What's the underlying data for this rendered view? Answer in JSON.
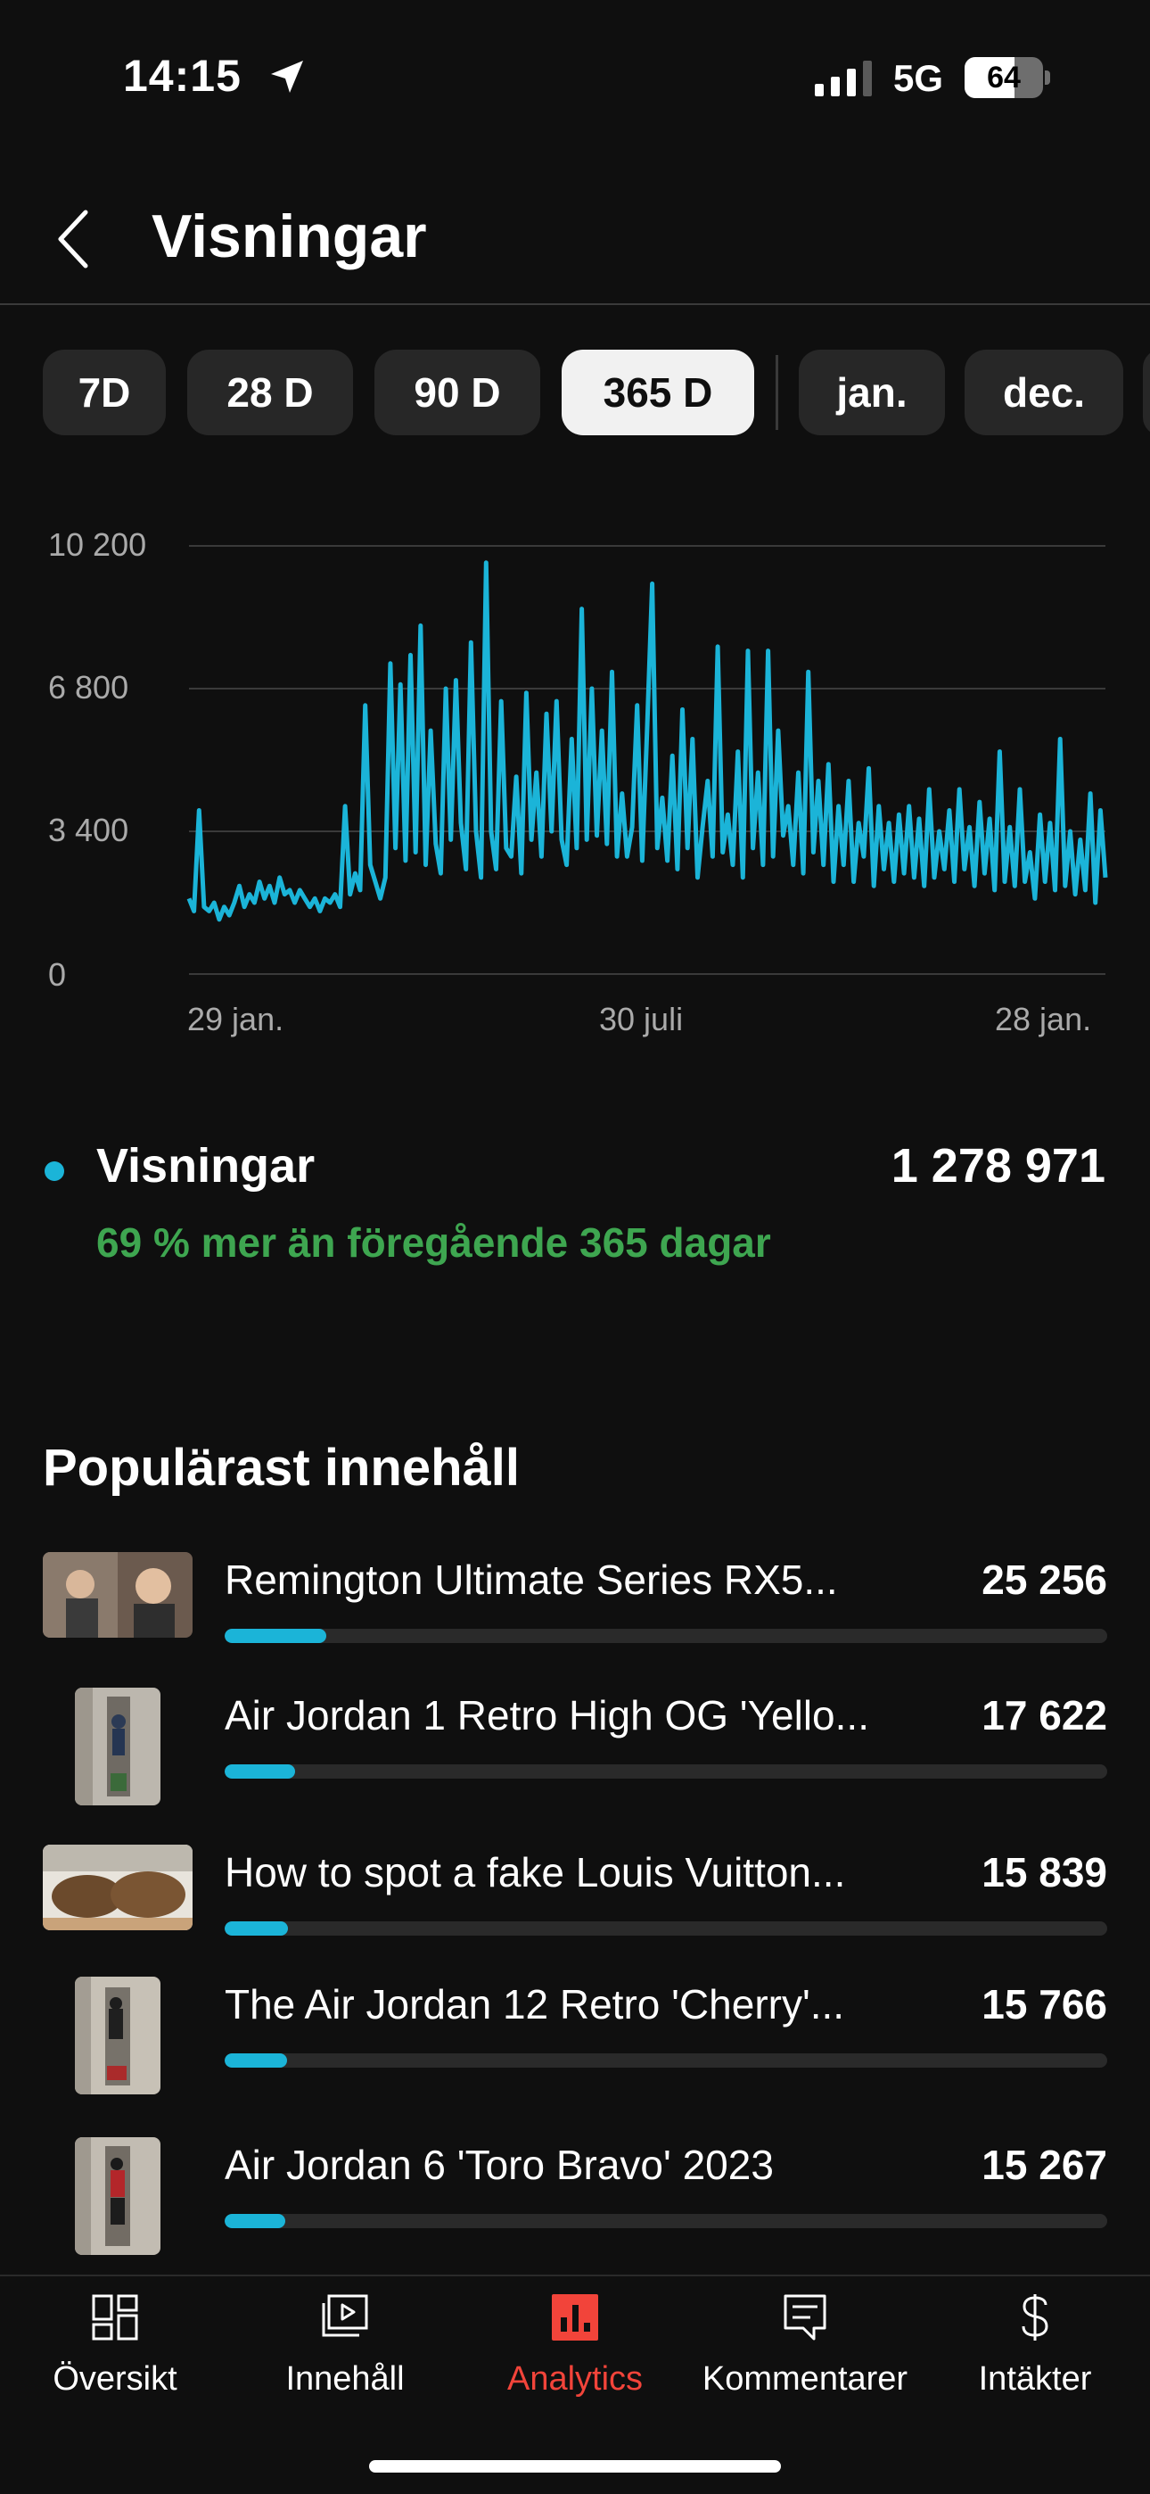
{
  "status": {
    "time": "14:15",
    "network": "5G",
    "battery": "64",
    "battery_level": 0.64
  },
  "header": {
    "title": "Visningar"
  },
  "periods": [
    {
      "label": "7D",
      "active": false
    },
    {
      "label": "28 D",
      "active": false
    },
    {
      "label": "90 D",
      "active": false
    },
    {
      "label": "365 D",
      "active": true
    },
    {
      "label": "jan.",
      "active": false
    },
    {
      "label": "dec.",
      "active": false
    }
  ],
  "chart_data": {
    "type": "line",
    "series_color": "#1bb4d8",
    "yticks": [
      "10 200",
      "6 800",
      "3 400",
      "0"
    ],
    "ytick_values": [
      10200,
      6800,
      3400,
      0
    ],
    "ylim": [
      0,
      10200
    ],
    "xticks": [
      "29 jan.",
      "30 juli",
      "28 jan."
    ],
    "x_range_days": [
      0,
      364
    ],
    "xtick_days": [
      0,
      182,
      364
    ],
    "grid": true,
    "series": [
      {
        "points": [
          [
            0,
            1800
          ],
          [
            2,
            1500
          ],
          [
            4,
            3900
          ],
          [
            6,
            1600
          ],
          [
            8,
            1500
          ],
          [
            10,
            1700
          ],
          [
            12,
            1300
          ],
          [
            14,
            1600
          ],
          [
            16,
            1400
          ],
          [
            18,
            1700
          ],
          [
            20,
            2100
          ],
          [
            22,
            1600
          ],
          [
            24,
            1900
          ],
          [
            26,
            1700
          ],
          [
            28,
            2200
          ],
          [
            30,
            1800
          ],
          [
            32,
            2100
          ],
          [
            34,
            1700
          ],
          [
            36,
            2300
          ],
          [
            38,
            1900
          ],
          [
            40,
            2000
          ],
          [
            42,
            1700
          ],
          [
            44,
            2000
          ],
          [
            46,
            1800
          ],
          [
            48,
            1600
          ],
          [
            50,
            1800
          ],
          [
            52,
            1500
          ],
          [
            54,
            1800
          ],
          [
            56,
            1700
          ],
          [
            58,
            1900
          ],
          [
            60,
            1600
          ],
          [
            62,
            4000
          ],
          [
            64,
            1900
          ],
          [
            66,
            2400
          ],
          [
            68,
            2000
          ],
          [
            70,
            6400
          ],
          [
            72,
            2600
          ],
          [
            74,
            2200
          ],
          [
            76,
            1800
          ],
          [
            78,
            2300
          ],
          [
            80,
            7400
          ],
          [
            82,
            3000
          ],
          [
            84,
            6900
          ],
          [
            86,
            2700
          ],
          [
            88,
            7600
          ],
          [
            90,
            2900
          ],
          [
            92,
            8300
          ],
          [
            94,
            2600
          ],
          [
            96,
            5800
          ],
          [
            98,
            3100
          ],
          [
            100,
            2400
          ],
          [
            102,
            6800
          ],
          [
            104,
            3200
          ],
          [
            106,
            7000
          ],
          [
            108,
            3600
          ],
          [
            110,
            2500
          ],
          [
            112,
            7900
          ],
          [
            114,
            3400
          ],
          [
            116,
            2300
          ],
          [
            118,
            9800
          ],
          [
            120,
            3400
          ],
          [
            122,
            2500
          ],
          [
            124,
            6500
          ],
          [
            126,
            3000
          ],
          [
            128,
            2800
          ],
          [
            130,
            4700
          ],
          [
            132,
            2400
          ],
          [
            134,
            6700
          ],
          [
            136,
            3200
          ],
          [
            138,
            4800
          ],
          [
            140,
            2800
          ],
          [
            142,
            6200
          ],
          [
            144,
            3400
          ],
          [
            146,
            6500
          ],
          [
            148,
            3200
          ],
          [
            150,
            2600
          ],
          [
            152,
            5600
          ],
          [
            154,
            3000
          ],
          [
            156,
            8700
          ],
          [
            158,
            3200
          ],
          [
            160,
            6800
          ],
          [
            162,
            3300
          ],
          [
            164,
            5800
          ],
          [
            166,
            3100
          ],
          [
            168,
            7200
          ],
          [
            170,
            2800
          ],
          [
            172,
            4300
          ],
          [
            174,
            2800
          ],
          [
            176,
            3500
          ],
          [
            178,
            6400
          ],
          [
            180,
            2700
          ],
          [
            182,
            5900
          ],
          [
            184,
            9300
          ],
          [
            186,
            3000
          ],
          [
            188,
            4200
          ],
          [
            190,
            2700
          ],
          [
            192,
            5200
          ],
          [
            194,
            2500
          ],
          [
            196,
            6300
          ],
          [
            198,
            3000
          ],
          [
            200,
            5600
          ],
          [
            202,
            2300
          ],
          [
            204,
            3500
          ],
          [
            206,
            4600
          ],
          [
            208,
            2800
          ],
          [
            210,
            7800
          ],
          [
            212,
            2900
          ],
          [
            214,
            3800
          ],
          [
            216,
            2600
          ],
          [
            218,
            5300
          ],
          [
            220,
            2300
          ],
          [
            222,
            7700
          ],
          [
            224,
            3000
          ],
          [
            226,
            4800
          ],
          [
            228,
            2600
          ],
          [
            230,
            7700
          ],
          [
            232,
            2800
          ],
          [
            234,
            5800
          ],
          [
            236,
            3300
          ],
          [
            238,
            4000
          ],
          [
            240,
            2600
          ],
          [
            242,
            4800
          ],
          [
            244,
            2400
          ],
          [
            246,
            7200
          ],
          [
            248,
            2900
          ],
          [
            250,
            4600
          ],
          [
            252,
            2600
          ],
          [
            254,
            5000
          ],
          [
            256,
            2200
          ],
          [
            258,
            4000
          ],
          [
            260,
            2600
          ],
          [
            262,
            4600
          ],
          [
            264,
            2200
          ],
          [
            266,
            3600
          ],
          [
            268,
            2800
          ],
          [
            270,
            4900
          ],
          [
            272,
            2100
          ],
          [
            274,
            4000
          ],
          [
            276,
            2500
          ],
          [
            278,
            3600
          ],
          [
            280,
            2200
          ],
          [
            282,
            3800
          ],
          [
            284,
            2400
          ],
          [
            286,
            4000
          ],
          [
            288,
            2300
          ],
          [
            290,
            3700
          ],
          [
            292,
            2100
          ],
          [
            294,
            4400
          ],
          [
            296,
            2300
          ],
          [
            298,
            3400
          ],
          [
            300,
            2500
          ],
          [
            302,
            3900
          ],
          [
            304,
            2200
          ],
          [
            306,
            4400
          ],
          [
            308,
            2500
          ],
          [
            310,
            3500
          ],
          [
            312,
            2100
          ],
          [
            314,
            4100
          ],
          [
            316,
            2400
          ],
          [
            318,
            3700
          ],
          [
            320,
            2000
          ],
          [
            322,
            5300
          ],
          [
            324,
            2200
          ],
          [
            326,
            3500
          ],
          [
            328,
            2100
          ],
          [
            330,
            4400
          ],
          [
            332,
            2200
          ],
          [
            334,
            2900
          ],
          [
            336,
            1800
          ],
          [
            338,
            3800
          ],
          [
            340,
            2200
          ],
          [
            342,
            3600
          ],
          [
            344,
            2000
          ],
          [
            346,
            5600
          ],
          [
            348,
            2100
          ],
          [
            350,
            3400
          ],
          [
            352,
            1900
          ],
          [
            354,
            3200
          ],
          [
            356,
            2000
          ],
          [
            358,
            4300
          ],
          [
            360,
            1700
          ],
          [
            362,
            3900
          ],
          [
            364,
            2300
          ]
        ]
      }
    ]
  },
  "metric": {
    "label": "Visningar",
    "value": "1 278 971",
    "change": "69 % mer än föregående 365 dagar"
  },
  "popular": {
    "title": "Populärast innehåll",
    "items": [
      {
        "title": "Remington Ultimate Series RX5...",
        "value": "25 256",
        "share": 0.115,
        "thumb_shape": "wide"
      },
      {
        "title": "Air Jordan 1 Retro High OG 'Yello...",
        "value": "17 622",
        "share": 0.08,
        "thumb_shape": "tall"
      },
      {
        "title": "How to spot a fake Louis Vuitton...",
        "value": "15 839",
        "share": 0.072,
        "thumb_shape": "wide"
      },
      {
        "title": "The Air Jordan 12 Retro 'Cherry'...",
        "value": "15 766",
        "share": 0.071,
        "thumb_shape": "tall"
      },
      {
        "title": "Air Jordan 6 'Toro Bravo' 2023",
        "value": "15 267",
        "share": 0.069,
        "thumb_shape": "tall"
      }
    ]
  },
  "nav": [
    {
      "label": "Översikt",
      "icon": "dashboard-icon",
      "active": false
    },
    {
      "label": "Innehåll",
      "icon": "content-icon",
      "active": false
    },
    {
      "label": "Analytics",
      "icon": "analytics-icon",
      "active": true
    },
    {
      "label": "Kommentarer",
      "icon": "comments-icon",
      "active": false
    },
    {
      "label": "Intäkter",
      "icon": "dollar-icon",
      "active": false
    }
  ],
  "colors": {
    "accent": "#1bb4d8",
    "positive": "#3ea650",
    "active_nav": "#f2443a",
    "background": "#0f0f0f"
  }
}
